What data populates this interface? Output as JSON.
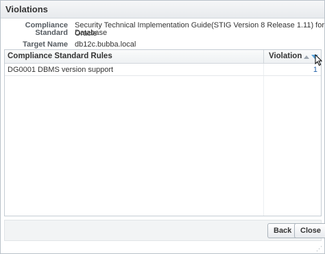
{
  "dialog": {
    "title": "Violations",
    "close_icon": "close-icon"
  },
  "form": {
    "compliance_standard_label_line1": "Compliance",
    "compliance_standard_label_line2": "Standard",
    "compliance_standard_value_line1": "Security Technical Implementation Guide(STIG Version 8 Release 1.11) for Oracle",
    "compliance_standard_value_line2": "Database",
    "target_name_label": "Target Name",
    "target_name_value": "db12c.bubba.local"
  },
  "table": {
    "columns": [
      "Compliance Standard Rules",
      "Violation C"
    ],
    "sort_icons": [
      "sort-ascending-icon",
      "sort-descending-icon"
    ],
    "rows": [
      {
        "rule": "DG0001 DBMS version support",
        "violations": "1"
      }
    ]
  },
  "footer": {
    "back_label": "Back",
    "close_label": "Close"
  }
}
